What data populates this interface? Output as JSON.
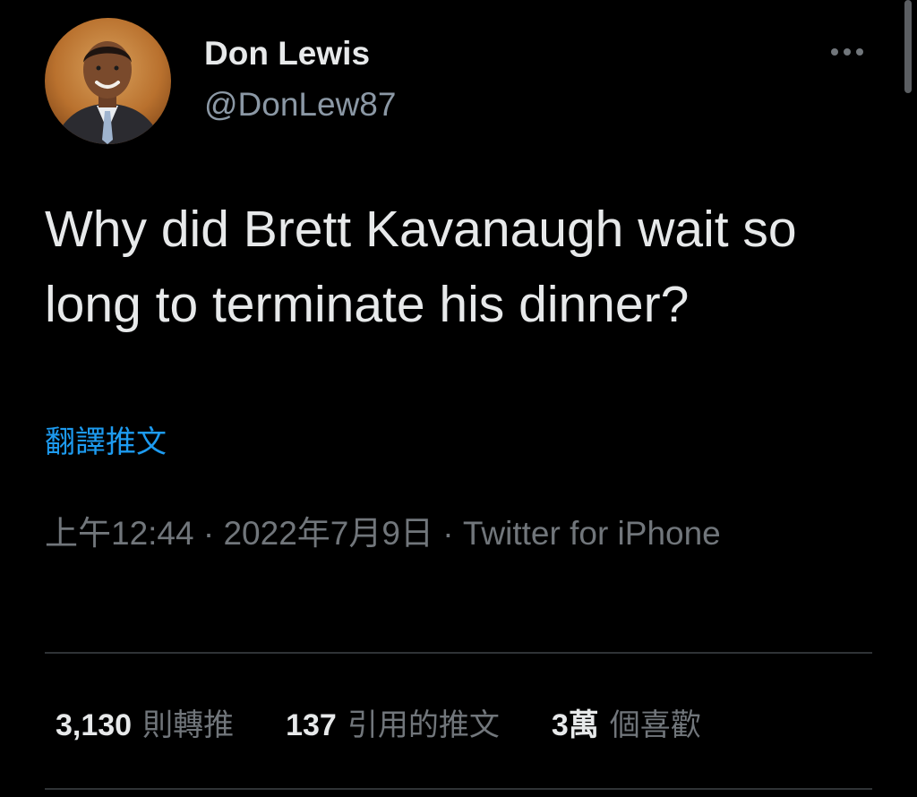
{
  "author": {
    "display_name": "Don Lewis",
    "handle": "@DonLew87",
    "avatar_icon": "profile-photo"
  },
  "more_icon": "more-horizontal-icon",
  "tweet": {
    "text": "Why did Brett Kavanaugh wait so long to terminate his dinner?",
    "translate_label": "翻譯推文"
  },
  "meta": {
    "time": "上午12:44",
    "separator": " · ",
    "date": "2022年7月9日",
    "source": "Twitter for iPhone"
  },
  "stats": {
    "retweets": {
      "count": "3,130",
      "label": "則轉推"
    },
    "quotes": {
      "count": "137",
      "label": "引用的推文"
    },
    "likes": {
      "count": "3萬",
      "label": "個喜歡"
    }
  },
  "colors": {
    "background": "#000000",
    "text_primary": "#e7e9ea",
    "text_secondary": "#71767b",
    "link": "#1d9bf0",
    "divider": "#2f3336"
  }
}
